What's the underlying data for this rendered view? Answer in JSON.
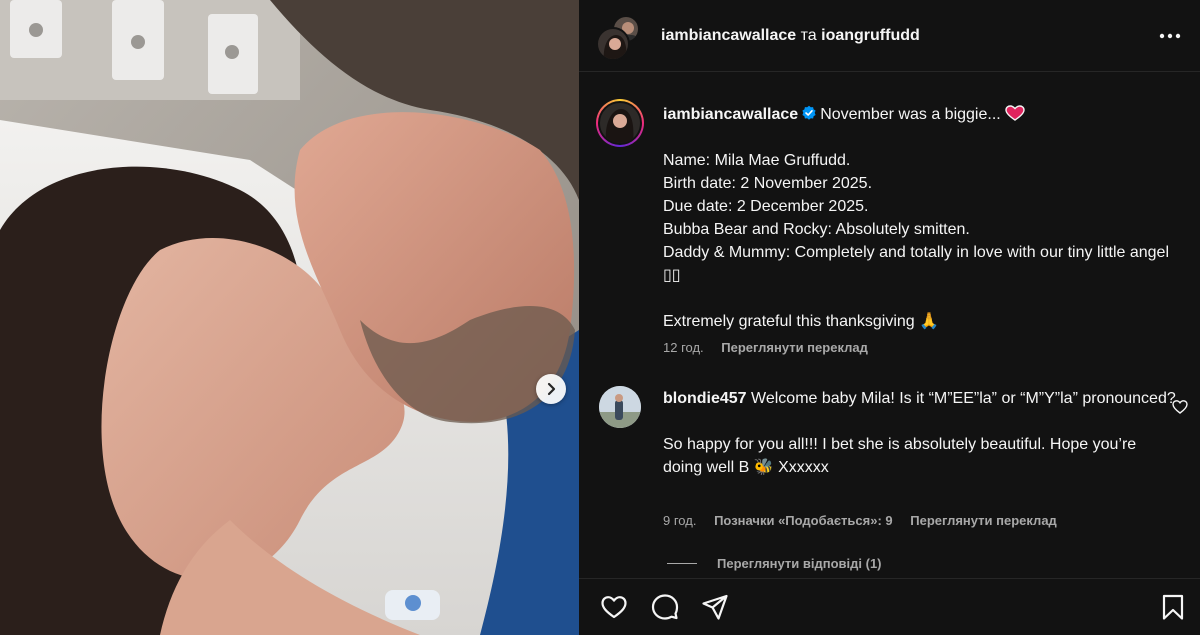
{
  "post": {
    "photo_alt": "couple kissing in hospital bed",
    "next_arrow_icon": "chevron-right-icon"
  },
  "header": {
    "author_1": "iambiancawallace",
    "separator": "та",
    "author_2": "ioangruffudd",
    "more_icon": "more-options-icon"
  },
  "caption": {
    "username": "iambiancawallace",
    "verified_icon": "verified-badge-icon",
    "first_line": "November was a biggie...",
    "heart_icon": "red-heart-emoji",
    "lines": [
      "Name: Mila Mae Gruffudd.",
      "Birth date: 2 November 2025.",
      "Due date: 2 December 2025.",
      "Bubba Bear and Rocky: Absolutely smitten.",
      "Daddy & Mummy: Completely and totally in love with our tiny little angel ▯▯"
    ],
    "closing": "Extremely grateful this thanksgiving",
    "closing_emoji": "🙏",
    "time": "12 год.",
    "see_translation": "Переглянути переклад"
  },
  "comment": {
    "username": "blondie457",
    "text_1": "Welcome baby Mila! Is it “M”EE”la” or “M”Y”la” pronounced?",
    "text_2": "So happy for you all!!! I bet she is absolutely beautiful. Hope you’re doing well B",
    "text_2_emoji": "🐝",
    "text_2_end": "Xxxxxx",
    "time": "9 год.",
    "likes": "Позначки «Подобається»: 9",
    "see_translation": "Переглянути переклад",
    "view_replies": "Переглянути відповіді (1)",
    "like_icon": "heart-outline-icon"
  },
  "actions": {
    "like_icon": "heart-icon",
    "comment_icon": "comment-icon",
    "share_icon": "share-icon",
    "save_icon": "bookmark-icon"
  },
  "colors": {
    "background": "#121212",
    "text": "#f5f5f5",
    "muted": "#a8a8a8",
    "verified": "#0095f6",
    "heart": "#e0245e"
  }
}
